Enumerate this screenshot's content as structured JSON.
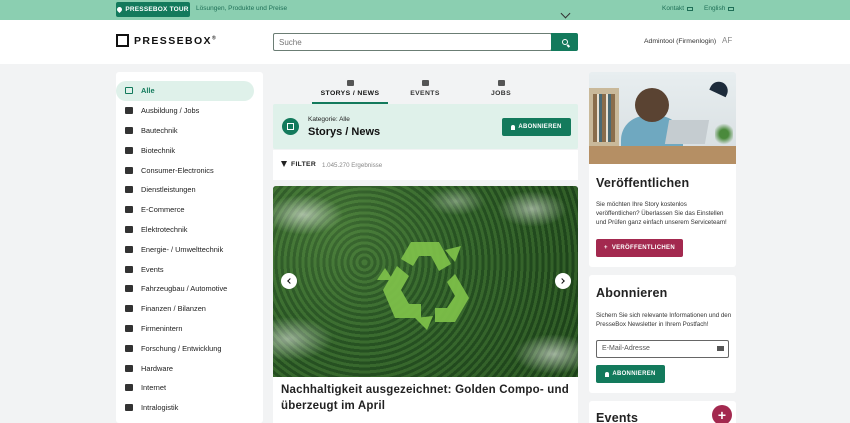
{
  "topbar": {
    "tour_label": "PRESSEBOX TOUR",
    "tagline": "Lösungen, Produkte und Preise",
    "kontakt": "Kontakt",
    "language": "English"
  },
  "header": {
    "logo_text": "PRESSEBOX",
    "logo_mark": "®",
    "search_placeholder": "Suche",
    "user": "Admintool (Firmenlogin)",
    "initials": "AF"
  },
  "sidebar": {
    "items": [
      {
        "label": "Alle",
        "icon": "grid-icon",
        "active": true
      },
      {
        "label": "Ausbildung / Jobs",
        "icon": "education-icon"
      },
      {
        "label": "Bautechnik",
        "icon": "construction-icon"
      },
      {
        "label": "Biotechnik",
        "icon": "biotech-icon"
      },
      {
        "label": "Consumer-Electronics",
        "icon": "devices-icon"
      },
      {
        "label": "Dienstleistungen",
        "icon": "service-icon"
      },
      {
        "label": "E-Commerce",
        "icon": "shop-icon"
      },
      {
        "label": "Elektrotechnik",
        "icon": "bolt-icon"
      },
      {
        "label": "Energie- / Umwelttechnik",
        "icon": "energy-icon"
      },
      {
        "label": "Events",
        "icon": "calendar-icon"
      },
      {
        "label": "Fahrzeugbau / Automotive",
        "icon": "car-icon"
      },
      {
        "label": "Finanzen / Bilanzen",
        "icon": "finance-icon"
      },
      {
        "label": "Firmenintern",
        "icon": "building-icon"
      },
      {
        "label": "Forschung / Entwicklung",
        "icon": "research-icon"
      },
      {
        "label": "Hardware",
        "icon": "chip-icon"
      },
      {
        "label": "Internet",
        "icon": "globe-icon"
      },
      {
        "label": "Intralogistik",
        "icon": "logistics-icon"
      }
    ]
  },
  "tabs": [
    {
      "label": "STORYS / NEWS",
      "active": true
    },
    {
      "label": "EVENTS"
    },
    {
      "label": "JOBS"
    }
  ],
  "category": {
    "label": "Kategorie: Alle",
    "title": "Storys / News",
    "subscribe": "ABONNIEREN"
  },
  "filter": {
    "label": "FILTER",
    "count": "1.045.270 Ergebnisse"
  },
  "hero": {
    "title": "Nachhaltigkeit ausgezeichnet: Golden Compo- und überzeugt im April"
  },
  "publish": {
    "heading": "Veröffentlichen",
    "text": "Sie möchten Ihre Story kostenlos veröffentlichen? Überlassen Sie das Einstellen und Prüfen ganz einfach unserem Serviceteam!",
    "button": "VERÖFFENTLICHEN"
  },
  "newsletter": {
    "heading": "Abonnieren",
    "text": "Sichern Sie sich relevante Informationen und den PresseBox Newsletter in Ihrem Postfach!",
    "placeholder": "E-Mail-Adresse",
    "button": "ABONNIEREN"
  },
  "events_card": {
    "heading": "Events",
    "fab": "+"
  },
  "colors": {
    "brand_green": "#137a5c",
    "topbar": "#8bcfb1",
    "accent_red": "#a3294f",
    "mint": "#dff1ea"
  }
}
